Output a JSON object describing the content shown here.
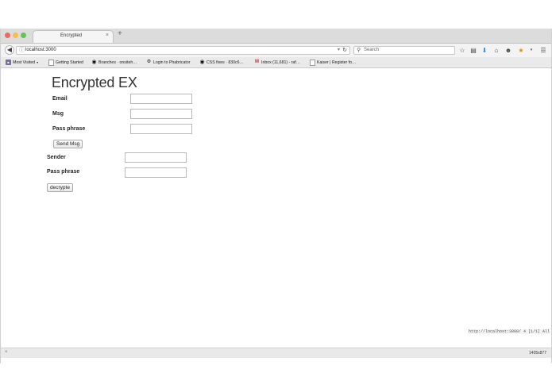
{
  "browser": {
    "tab_title": "Encrypted",
    "tab_close": "×",
    "new_tab": "+",
    "url": "localhost:3000",
    "search_placeholder": "Search",
    "bookmarks": [
      {
        "label": "Most Visited",
        "icon": "folder-icon"
      },
      {
        "label": "Getting Started",
        "icon": "page-icon"
      },
      {
        "label": "Branches · onsiteh…",
        "icon": "github-icon"
      },
      {
        "label": "Login to Phabricator",
        "icon": "phabricator-icon"
      },
      {
        "label": "CSS fixes · 830c6…",
        "icon": "github-icon"
      },
      {
        "label": "Inbox (11,681) - raf…",
        "icon": "gmail-icon"
      },
      {
        "label": "Kaiser | Register fo…",
        "icon": "page-icon"
      }
    ],
    "toolbar_icons": [
      "bookmark-star-icon",
      "reading-list-icon",
      "download-icon",
      "home-icon",
      "chat-icon",
      "extension-icon",
      "menu-icon"
    ]
  },
  "page": {
    "title": "Encrypted EX",
    "send_form": {
      "email_label": "Email",
      "msg_label": "Msg",
      "pass_label": "Pass phrase",
      "email_value": "",
      "msg_value": "",
      "pass_value": "",
      "button_label": "Send Msg"
    },
    "decrypt_form": {
      "sender_label": "Sender",
      "pass_label": "Pass phrase",
      "sender_value": "",
      "pass_value": "",
      "button_label": "decrypte"
    }
  },
  "status": {
    "close": "×",
    "viewport_size": "1405x877",
    "hover_url": "http://localhost:3000/ 4 [1/1] All"
  }
}
